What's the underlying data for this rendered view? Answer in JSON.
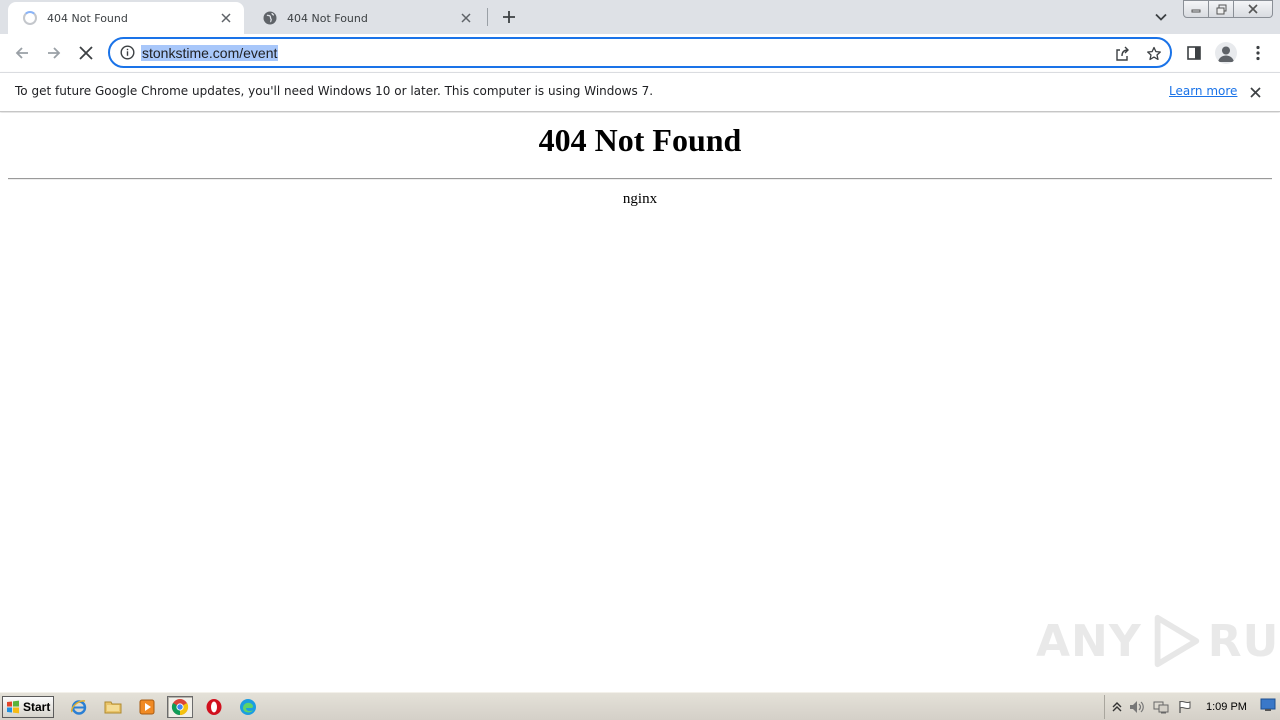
{
  "tabs": [
    {
      "title": "404 Not Found",
      "state": "loading",
      "active": true
    },
    {
      "title": "404 Not Found",
      "state": "loaded",
      "active": false
    }
  ],
  "toolbar": {
    "url": "stonkstime.com/event"
  },
  "infobar": {
    "message": "To get future Google Chrome updates, you'll need Windows 10 or later. This computer is using Windows 7.",
    "link_label": "Learn more"
  },
  "page": {
    "heading": "404 Not Found",
    "server": "nginx"
  },
  "watermark": {
    "left_text": "ANY",
    "right_text": "RUN"
  },
  "taskbar": {
    "start_label": "Start",
    "apps": [
      "internet-explorer",
      "file-explorer",
      "media-player",
      "chrome",
      "opera",
      "edge"
    ],
    "clock": "1:09 PM"
  },
  "colors": {
    "accent": "#1a73e8",
    "url_selection": "#a8c7fa",
    "tabstrip_bg": "#dee1e6",
    "taskbar_bg": "#d4d0c8"
  }
}
